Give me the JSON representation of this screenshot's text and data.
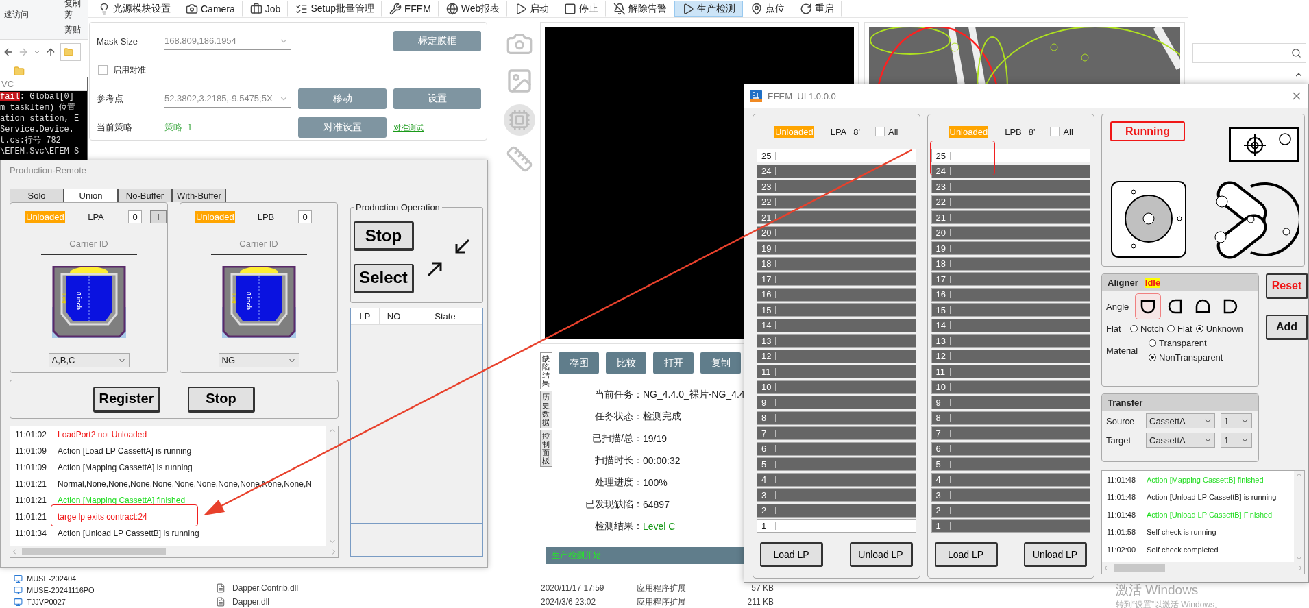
{
  "explorer": {
    "ribbon": [
      "复制",
      "速访问",
      "剪",
      "剪贴"
    ],
    "nav_items": [
      "MUSE-202404",
      "MUSE-20241116PO",
      "TJJVP0027"
    ],
    "files": [
      {
        "name": "Dapper.Contrib.dll",
        "date": "2020/11/17 17:59",
        "type": "应用程序扩展",
        "size": "57 KB"
      },
      {
        "name": "Dapper.dll",
        "date": "2024/3/6 23:02",
        "type": "应用程序扩展",
        "size": "211 KB"
      }
    ],
    "activation": {
      "title": "激活 Windows",
      "hint": "转到“设置”以激活 Windows。"
    }
  },
  "console": {
    "title": "VC",
    "lines": [
      {
        "tag": "fail",
        "text": ": Global[0]"
      },
      {
        "text": "m taskItem) 位置"
      },
      {
        "text": "ation station, E"
      },
      {
        "text": " Service.Device."
      },
      {
        "text": "t.cs:行号 782"
      },
      {
        "text": "\\EFEM.Svc\\EFEM S"
      }
    ]
  },
  "main_app": {
    "toolbar": [
      {
        "label": "光源模块设置",
        "selected": false
      },
      {
        "label": "Camera",
        "selected": false
      },
      {
        "label": "Job",
        "selected": false
      },
      {
        "label": "Setup批量管理",
        "selected": false
      },
      {
        "label": "EFEM",
        "selected": false
      },
      {
        "label": "Web报表",
        "selected": false
      },
      {
        "label": "启动",
        "selected": false
      },
      {
        "label": "停止",
        "selected": false
      },
      {
        "label": "解除告警",
        "selected": false
      },
      {
        "label": "生产检测",
        "selected": true
      },
      {
        "label": "点位",
        "selected": false
      },
      {
        "label": "重启",
        "selected": false
      }
    ],
    "alignment": {
      "mask_size": {
        "label": "Mask Size",
        "value": "168.809,186.1954"
      },
      "calibrate_button": "标定膜框",
      "enable_align": {
        "label": "启用对准",
        "checked": false
      },
      "reference": {
        "label": "参考点",
        "value": "52.3802,3.2185,-9.5475;5X"
      },
      "move_button": "移动",
      "set_button": "设置",
      "strategy": {
        "label": "当前策略",
        "value": "策略_1"
      },
      "align_settings_button": "对准设置",
      "align_test_link": "对准测试"
    },
    "image_buttons": [
      "存图",
      "比较",
      "打开",
      "复制"
    ],
    "side_tabs": [
      {
        "label": "缺陷结果",
        "selected": true
      },
      {
        "label": "历史数据",
        "selected": false
      },
      {
        "label": "控制面板",
        "selected": false
      }
    ],
    "task_info": [
      {
        "label": "当前任务：",
        "value": "NG_4.4.0_裸片-NG_4.4",
        "kind": "text"
      },
      {
        "label": "任务状态：",
        "value": "检测完成",
        "kind": "text"
      },
      {
        "label": "已扫描/总：",
        "value": "19/19",
        "kind": "text"
      },
      {
        "label": "扫描时长：",
        "value": "00:00:32",
        "kind": "text"
      },
      {
        "label": "处理进度：",
        "value": "100%",
        "kind": "text"
      },
      {
        "label": "已发现缺陷：",
        "value": "64897",
        "kind": "text"
      },
      {
        "label": "检测结果：",
        "value": "Level C",
        "kind": "result"
      }
    ],
    "status": "生产检测开始"
  },
  "production_remote": {
    "title": "Production-Remote",
    "tabs": [
      {
        "label": "Solo",
        "selected": false
      },
      {
        "label": "Union",
        "selected": true
      },
      {
        "label": "No-Buffer",
        "selected": false
      },
      {
        "label": "With-Buffer",
        "selected": false
      }
    ],
    "load_ports": [
      {
        "status": "Unloaded",
        "name": "LPA",
        "count": "0",
        "button": "I",
        "carrier_label": "Carrier ID",
        "carrier_size": "8 inch",
        "carrier_side": "Left",
        "select": "A,B,C"
      },
      {
        "status": "Unloaded",
        "name": "LPB",
        "count": "0",
        "carrier_label": "Carrier ID",
        "carrier_size": "8 inch",
        "carrier_side": "Left",
        "select": "NG"
      }
    ],
    "register_button": "Register",
    "stop_button": "Stop",
    "operation": {
      "title": "Production Operation",
      "buttons": [
        "Stop",
        "Select"
      ]
    },
    "table": {
      "columns": [
        "LP",
        "NO",
        "State"
      ]
    },
    "log": [
      {
        "time": "11:01:02",
        "text": "LoadPort2 not Unloaded",
        "kind": "error"
      },
      {
        "time": "11:01:09",
        "text": "Action [Load LP CassettA] is running",
        "kind": "info"
      },
      {
        "time": "11:01:09",
        "text": "Action [Mapping CassettA] is running",
        "kind": "info"
      },
      {
        "time": "11:01:21",
        "text": "Normal,None,None,None,None,None,None,None,None,None,None,N",
        "kind": "info"
      },
      {
        "time": "11:01:21",
        "text": "Action [Mapping CassettA] finished",
        "kind": "success"
      },
      {
        "time": "11:01:21",
        "text": "targe lp exits contract:24",
        "kind": "error"
      },
      {
        "time": "11:01:34",
        "text": "Action [Unload LP CassettB] is running",
        "kind": "info"
      }
    ]
  },
  "efem": {
    "title": "EFEM_UI 1.0.0.0",
    "ports": [
      {
        "status": "Unloaded",
        "name": "LPA",
        "size": "8'",
        "all_label": "All",
        "all_checked": false,
        "load_button": "Load LP",
        "unload_button": "Unload LP",
        "slots": [
          {
            "number": "25",
            "occupied": false
          },
          {
            "number": "24",
            "occupied": true
          },
          {
            "number": "23",
            "occupied": true
          },
          {
            "number": "22",
            "occupied": true
          },
          {
            "number": "21",
            "occupied": true
          },
          {
            "number": "20",
            "occupied": true
          },
          {
            "number": "19",
            "occupied": true
          },
          {
            "number": "18",
            "occupied": true
          },
          {
            "number": "17",
            "occupied": true
          },
          {
            "number": "16",
            "occupied": true
          },
          {
            "number": "15",
            "occupied": true
          },
          {
            "number": "14",
            "occupied": true
          },
          {
            "number": "13",
            "occupied": true
          },
          {
            "number": "12",
            "occupied": true
          },
          {
            "number": "11",
            "occupied": true
          },
          {
            "number": "10",
            "occupied": true
          },
          {
            "number": "9",
            "occupied": true
          },
          {
            "number": "8",
            "occupied": true
          },
          {
            "number": "7",
            "occupied": true
          },
          {
            "number": "6",
            "occupied": true
          },
          {
            "number": "5",
            "occupied": true
          },
          {
            "number": "4",
            "occupied": true
          },
          {
            "number": "3",
            "occupied": true
          },
          {
            "number": "2",
            "occupied": true
          },
          {
            "number": "1",
            "occupied": false
          }
        ]
      },
      {
        "status": "Unloaded",
        "name": "LPB",
        "size": "8'",
        "all_label": "All",
        "all_checked": false,
        "load_button": "Load LP",
        "unload_button": "Unload LP",
        "slots": [
          {
            "number": "25",
            "occupied": false
          },
          {
            "number": "24",
            "occupied": true
          },
          {
            "number": "23",
            "occupied": true
          },
          {
            "number": "22",
            "occupied": true
          },
          {
            "number": "21",
            "occupied": true
          },
          {
            "number": "20",
            "occupied": true
          },
          {
            "number": "19",
            "occupied": true
          },
          {
            "number": "18",
            "occupied": true
          },
          {
            "number": "17",
            "occupied": true
          },
          {
            "number": "16",
            "occupied": true
          },
          {
            "number": "15",
            "occupied": true
          },
          {
            "number": "14",
            "occupied": true
          },
          {
            "number": "13",
            "occupied": true
          },
          {
            "number": "12",
            "occupied": true
          },
          {
            "number": "11",
            "occupied": true
          },
          {
            "number": "10",
            "occupied": true
          },
          {
            "number": "9",
            "occupied": true
          },
          {
            "number": "8",
            "occupied": true
          },
          {
            "number": "7",
            "occupied": true
          },
          {
            "number": "6",
            "occupied": true
          },
          {
            "number": "5",
            "occupied": true
          },
          {
            "number": "4",
            "occupied": true
          },
          {
            "number": "3",
            "occupied": true
          },
          {
            "number": "2",
            "occupied": true
          },
          {
            "number": "1",
            "occupied": true
          }
        ]
      }
    ],
    "state": "Running",
    "aligner": {
      "title": "Aligner",
      "state": "Idle",
      "angle_label": "Angle",
      "angles": [
        {
          "selected": true
        },
        {
          "selected": false
        },
        {
          "selected": false
        },
        {
          "selected": false
        }
      ],
      "flat_label": "Flat",
      "flat_options": [
        {
          "label": "Notch",
          "selected": false
        },
        {
          "label": "Flat",
          "selected": false
        },
        {
          "label": "Unknown",
          "selected": true
        }
      ],
      "material_label": "Material",
      "materials": [
        {
          "label": "Transparent",
          "selected": false
        },
        {
          "label": "NonTransparent",
          "selected": true
        }
      ]
    },
    "reset_button": "Reset",
    "add_button": "Add",
    "transfer": {
      "title": "Transfer",
      "rows": [
        {
          "label": "Source",
          "cassette": "CassettA",
          "slot": "1"
        },
        {
          "label": "Target",
          "cassette": "CassettA",
          "slot": "1"
        }
      ]
    },
    "log": [
      {
        "time": "11:01:48",
        "text": "Action [Mapping CassettB] finished",
        "kind": "success"
      },
      {
        "time": "11:01:48",
        "text": "Action [Unload LP CassettB] is running",
        "kind": "info"
      },
      {
        "time": "11:01:48",
        "text": "Action [Unload LP CassettB] Finished",
        "kind": "success"
      },
      {
        "time": "11:01:58",
        "text": "Self check is running",
        "kind": "info"
      },
      {
        "time": "11:02:00",
        "text": "Self check completed",
        "kind": "info"
      }
    ]
  }
}
